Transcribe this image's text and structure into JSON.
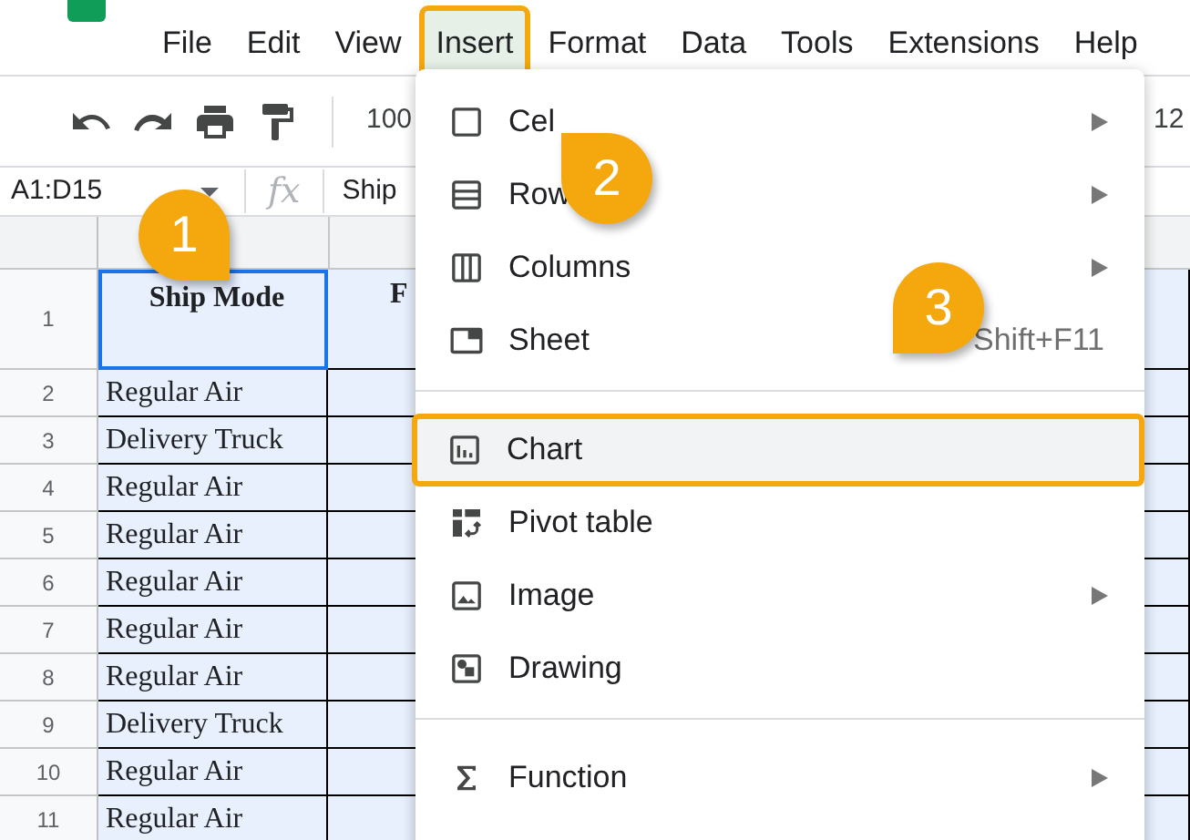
{
  "menu_bar": [
    {
      "label": "File",
      "selected": false
    },
    {
      "label": "Edit",
      "selected": false
    },
    {
      "label": "View",
      "selected": false
    },
    {
      "label": "Insert",
      "selected": true
    },
    {
      "label": "Format",
      "selected": false
    },
    {
      "label": "Data",
      "selected": false
    },
    {
      "label": "Tools",
      "selected": false
    },
    {
      "label": "Extensions",
      "selected": false
    },
    {
      "label": "Help",
      "selected": false
    }
  ],
  "toolbar": {
    "zoom": "100",
    "font_size": "12"
  },
  "formula_bar": {
    "name_box": "A1:D15",
    "fx": "fx",
    "content": "Ship"
  },
  "sheet": {
    "header_row": {
      "number": "1",
      "column_a": "Ship Mode",
      "column_b": "F"
    },
    "rows": [
      {
        "number": "2",
        "column_a": "Regular Air"
      },
      {
        "number": "3",
        "column_a": "Delivery Truck"
      },
      {
        "number": "4",
        "column_a": "Regular Air"
      },
      {
        "number": "5",
        "column_a": "Regular Air"
      },
      {
        "number": "6",
        "column_a": "Regular Air"
      },
      {
        "number": "7",
        "column_a": "Regular Air"
      },
      {
        "number": "8",
        "column_a": "Regular Air"
      },
      {
        "number": "9",
        "column_a": "Delivery Truck"
      },
      {
        "number": "10",
        "column_a": "Regular Air"
      },
      {
        "number": "11",
        "column_a": "Regular Air"
      }
    ]
  },
  "insert_menu": [
    {
      "kind": "item",
      "label": "Cel",
      "submenu": true,
      "highlighted": false
    },
    {
      "kind": "item",
      "label": "Row",
      "submenu": true,
      "highlighted": false
    },
    {
      "kind": "item",
      "label": "Columns",
      "submenu": true,
      "highlighted": false
    },
    {
      "kind": "item",
      "label": "Sheet",
      "shortcut": "Shift+F11",
      "submenu": false,
      "highlighted": false
    },
    {
      "kind": "divider"
    },
    {
      "kind": "item",
      "label": "Chart",
      "submenu": false,
      "highlighted": true
    },
    {
      "kind": "item",
      "label": "Pivot table",
      "submenu": false,
      "highlighted": false
    },
    {
      "kind": "item",
      "label": "Image",
      "submenu": true,
      "highlighted": false
    },
    {
      "kind": "item",
      "label": "Drawing",
      "submenu": false,
      "highlighted": false
    },
    {
      "kind": "divider"
    },
    {
      "kind": "item",
      "label": "Function",
      "submenu": true,
      "highlighted": false
    }
  ],
  "callouts": [
    {
      "number": "1"
    },
    {
      "number": "2"
    },
    {
      "number": "3"
    }
  ]
}
